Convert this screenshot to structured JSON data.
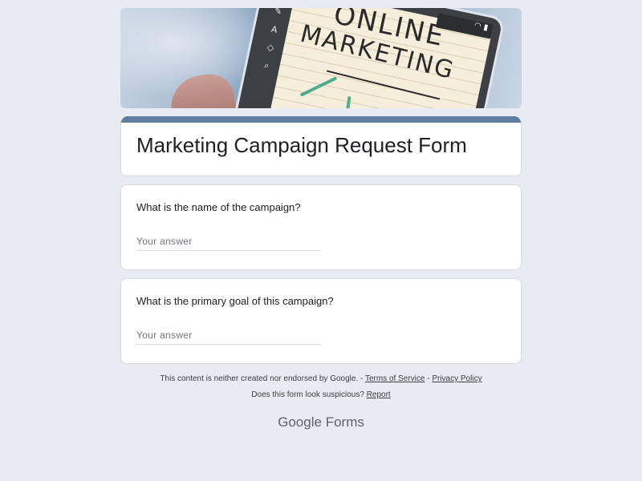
{
  "banner": {
    "line1": "ONLINE",
    "line2": "MARKETING"
  },
  "form": {
    "title": "Marketing Campaign Request Form"
  },
  "questions": [
    {
      "label": "What is the name of the campaign?",
      "placeholder": "Your answer"
    },
    {
      "label": "What is the primary goal of this campaign?",
      "placeholder": "Your answer"
    }
  ],
  "footer": {
    "disclaimer": "This content is neither created nor endorsed by Google.",
    "sep1": "-",
    "terms": "Terms of Service",
    "sep2": "-",
    "privacy": "Privacy Policy",
    "suspicious": "Does this form look suspicious?",
    "report": "Report"
  },
  "brand": {
    "google": "Google",
    "forms": "Forms"
  }
}
